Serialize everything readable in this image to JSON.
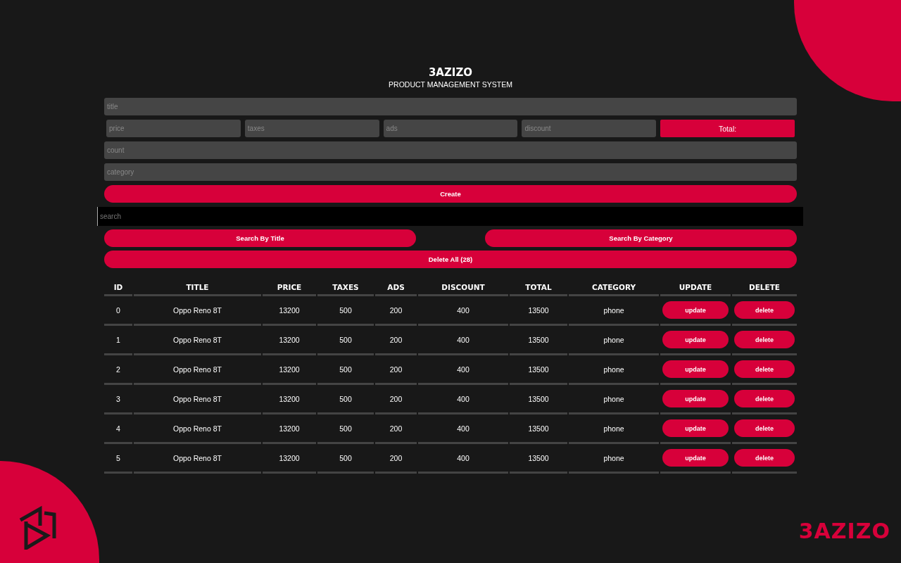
{
  "header": {
    "title": "3AZIZO",
    "subtitle": "PRODUCT MANAGEMENT SYSTEM"
  },
  "form": {
    "title": {
      "placeholder": "title"
    },
    "price_row": [
      {
        "placeholder": "price"
      },
      {
        "placeholder": "taxes"
      },
      {
        "placeholder": "ads"
      },
      {
        "placeholder": "discount"
      }
    ],
    "total": "Total:",
    "count": {
      "placeholder": "count"
    },
    "category": {
      "placeholder": "category"
    },
    "create": "Create"
  },
  "search": {
    "placeholder": "search"
  },
  "search_buttons": [
    "Search By Title",
    "Search By Category"
  ],
  "delete_all": "Delete All (28)",
  "table": {
    "columns": [
      "ID",
      "TITLE",
      "PRICE",
      "TAXES",
      "ADS",
      "DISCOUNT",
      "TOTAL",
      "CATEGORY",
      "UPDATE",
      "DELETE"
    ],
    "rows": [
      {
        "id": "0",
        "title": "Oppo Reno 8T",
        "price": "13200",
        "taxes": "500",
        "ads": "200",
        "discount": "400",
        "total": "13500",
        "category": "phone",
        "update": "update",
        "delete": "delete"
      },
      {
        "id": "1",
        "title": "Oppo Reno 8T",
        "price": "13200",
        "taxes": "500",
        "ads": "200",
        "discount": "400",
        "total": "13500",
        "category": "phone",
        "update": "update",
        "delete": "delete"
      },
      {
        "id": "2",
        "title": "Oppo Reno 8T",
        "price": "13200",
        "taxes": "500",
        "ads": "200",
        "discount": "400",
        "total": "13500",
        "category": "phone",
        "update": "update",
        "delete": "delete"
      },
      {
        "id": "3",
        "title": "Oppo Reno 8T",
        "price": "13200",
        "taxes": "500",
        "ads": "200",
        "discount": "400",
        "total": "13500",
        "category": "phone",
        "update": "update",
        "delete": "delete"
      },
      {
        "id": "4",
        "title": "Oppo Reno 8T",
        "price": "13200",
        "taxes": "500",
        "ads": "200",
        "discount": "400",
        "total": "13500",
        "category": "phone",
        "update": "update",
        "delete": "delete"
      },
      {
        "id": "5",
        "title": "Oppo Reno 8T",
        "price": "13200",
        "taxes": "500",
        "ads": "200",
        "discount": "400",
        "total": "13500",
        "category": "phone",
        "update": "update",
        "delete": "delete"
      }
    ]
  },
  "brand": {
    "wordmark": "3AZIZO"
  }
}
